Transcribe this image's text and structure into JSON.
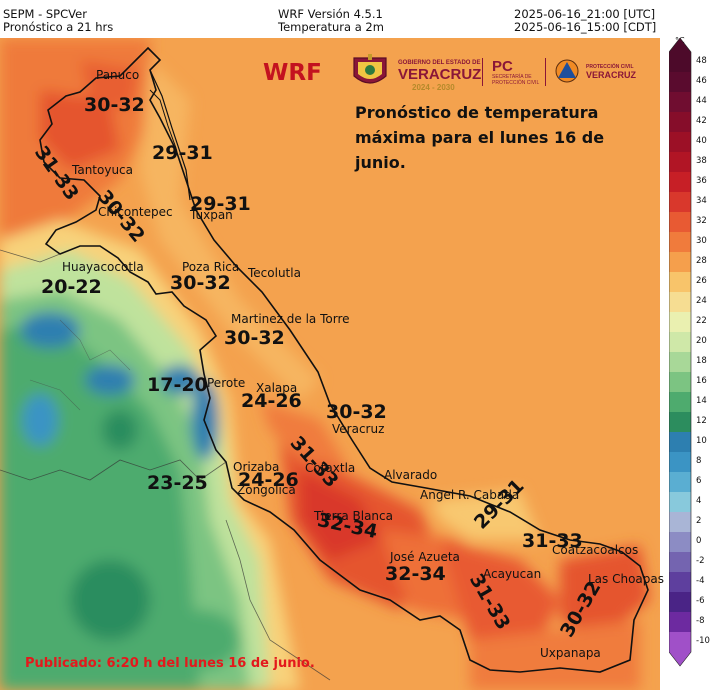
{
  "header": {
    "left_line1": "SEPM - SPCVer",
    "left_line2": "Pronóstico a 21 hrs",
    "center_line1": "WRF Versión 4.5.1",
    "center_line2": "Temperatura a 2m",
    "right_line1": "2025-06-16_21:00 [UTC]",
    "right_line2": "2025-06-16_15:00 [CDT]"
  },
  "logos": {
    "wrf": "WRF",
    "veracruz_gov_small": "GOBIERNO DEL ESTADO DE",
    "veracruz_gov_big": "VERACRUZ",
    "veracruz_gov_years": "2024 - 2030",
    "pc": "PC",
    "pc_sub": "SECRETARÍA DE PROTECCIÓN CIVIL",
    "pc_state_small": "PROTECCIÓN CIVIL",
    "pc_state_big": "VERACRUZ"
  },
  "forecast_note": "Pronóstico de temperatura máxima para el lunes 16 de junio.",
  "published": "Publicado: 6:20 h del lunes 16 de junio.",
  "colorbar": {
    "unit": "°C",
    "ticks": [
      "48",
      "46",
      "44",
      "42",
      "40",
      "38",
      "36",
      "34",
      "32",
      "30",
      "28",
      "26",
      "24",
      "22",
      "20",
      "18",
      "16",
      "14",
      "12",
      "10",
      "8",
      "6",
      "4",
      "2",
      "0",
      "-2",
      "-4",
      "-6",
      "-8",
      "-10"
    ],
    "colors": [
      "#4d0a2a",
      "#5a0b2e",
      "#700d30",
      "#860d2a",
      "#9c1026",
      "#b11525",
      "#c71f26",
      "#d9382c",
      "#e85a33",
      "#f07b3c",
      "#f59f4c",
      "#f8c46a",
      "#f6dd92",
      "#eaf0b0",
      "#cfe8a8",
      "#a8d898",
      "#7cc482",
      "#4eab6e",
      "#2c8d5e",
      "#2d7fb0",
      "#3b94c4",
      "#5aaed2",
      "#88c9dc",
      "#a9b5d6",
      "#8c8cc4",
      "#7464b0",
      "#5e3f9e",
      "#4a2486",
      "#6d2aa0",
      "#a050c8"
    ],
    "min": -10,
    "max": 48,
    "step": 2
  },
  "ranges": [
    {
      "id": "panuco",
      "text": "30-32"
    },
    {
      "id": "tantoyuca",
      "text": "31-33"
    },
    {
      "id": "tuxpan-north",
      "text": "29-31"
    },
    {
      "id": "tuxpan",
      "text": "29-31"
    },
    {
      "id": "chicontepec",
      "text": "30-32"
    },
    {
      "id": "huayacocotla",
      "text": "20-22"
    },
    {
      "id": "poza-rica",
      "text": "30-32"
    },
    {
      "id": "martinez",
      "text": "30-32"
    },
    {
      "id": "perote",
      "text": "17-20"
    },
    {
      "id": "xalapa",
      "text": "24-26"
    },
    {
      "id": "veracruz",
      "text": "30-32"
    },
    {
      "id": "cotaxtla",
      "text": "31-33"
    },
    {
      "id": "orizaba",
      "text": "23-25"
    },
    {
      "id": "zongolica",
      "text": "24-26"
    },
    {
      "id": "tierra-blanca",
      "text": "32-34"
    },
    {
      "id": "angel-cabada",
      "text": "29-31"
    },
    {
      "id": "coatzacoalcos",
      "text": "31-33"
    },
    {
      "id": "jose-azueta",
      "text": "32-34"
    },
    {
      "id": "acayucan",
      "text": "31-33"
    },
    {
      "id": "las-choapas",
      "text": "30-32"
    }
  ],
  "places": [
    {
      "id": "panuco",
      "text": "Panuco"
    },
    {
      "id": "tantoyuca",
      "text": "Tantoyuca"
    },
    {
      "id": "chicontepec",
      "text": "Chicontepec"
    },
    {
      "id": "tuxpan",
      "text": "Tuxpan"
    },
    {
      "id": "huayacocotla",
      "text": "Huayacocotla"
    },
    {
      "id": "poza-rica",
      "text": "Poza Rica"
    },
    {
      "id": "tecolutla",
      "text": "Tecolutla"
    },
    {
      "id": "martinez",
      "text": "Martinez de la Torre"
    },
    {
      "id": "perote",
      "text": "Perote"
    },
    {
      "id": "xalapa",
      "text": "Xalapa"
    },
    {
      "id": "veracruz",
      "text": "Veracruz"
    },
    {
      "id": "cotaxtla",
      "text": "Cotaxtla"
    },
    {
      "id": "alvarado",
      "text": "Alvarado"
    },
    {
      "id": "orizaba",
      "text": "Orizaba"
    },
    {
      "id": "zongolica",
      "text": "Zongolica"
    },
    {
      "id": "tierra-blanca",
      "text": "Tierra Blanca"
    },
    {
      "id": "angel-cabada",
      "text": "Angel R. Cabada"
    },
    {
      "id": "coatzacoalcos",
      "text": "Coatzacoalcos"
    },
    {
      "id": "jose-azueta",
      "text": "José Azueta"
    },
    {
      "id": "acayucan",
      "text": "Acayucan"
    },
    {
      "id": "las-choapas",
      "text": "Las Choapas"
    },
    {
      "id": "uxpanapa",
      "text": "Uxpanapa"
    }
  ]
}
